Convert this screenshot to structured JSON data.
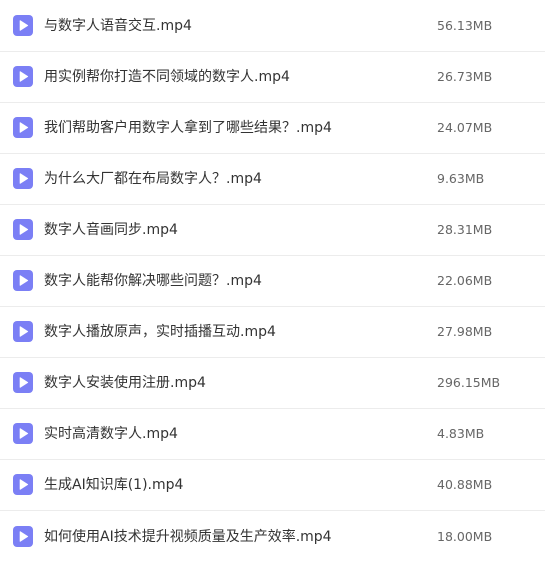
{
  "files": [
    {
      "name": "与数字人语音交互.mp4",
      "size": "56.13MB",
      "icon": "video-file-icon"
    },
    {
      "name": "用实例帮你打造不同领域的数字人.mp4",
      "size": "26.73MB",
      "icon": "video-file-icon"
    },
    {
      "name": "我们帮助客户用数字人拿到了哪些结果？.mp4",
      "size": "24.07MB",
      "icon": "video-file-icon"
    },
    {
      "name": "为什么大厂都在布局数字人？.mp4",
      "size": "9.63MB",
      "icon": "video-file-icon"
    },
    {
      "name": "数字人音画同步.mp4",
      "size": "28.31MB",
      "icon": "video-file-icon"
    },
    {
      "name": "数字人能帮你解决哪些问题？.mp4",
      "size": "22.06MB",
      "icon": "video-file-icon"
    },
    {
      "name": "数字人播放原声，实时插播互动.mp4",
      "size": "27.98MB",
      "icon": "video-file-icon"
    },
    {
      "name": "数字人安装使用注册.mp4",
      "size": "296.15MB",
      "icon": "video-file-icon"
    },
    {
      "name": "实时高清数字人.mp4",
      "size": "4.83MB",
      "icon": "video-file-icon"
    },
    {
      "name": "生成AI知识库(1).mp4",
      "size": "40.88MB",
      "icon": "video-file-icon"
    },
    {
      "name": "如何使用AI技术提升视频质量及生产效率.mp4",
      "size": "18.00MB",
      "icon": "video-file-icon"
    }
  ],
  "colors": {
    "icon_fill": "#7b7ff5",
    "icon_play": "#ffffff",
    "divider": "#ececec"
  }
}
